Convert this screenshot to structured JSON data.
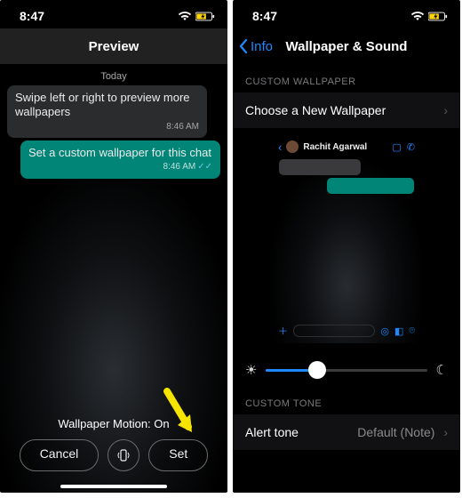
{
  "left": {
    "time": "8:47",
    "title": "Preview",
    "dateLabel": "Today",
    "msg_in": "Swipe left or right to preview more wallpapers",
    "msg_in_ts": "8:46 AM",
    "msg_out": "Set a custom wallpaper for this chat",
    "msg_out_ts": "8:46 AM",
    "motion": "Wallpaper Motion: On",
    "cancel": "Cancel",
    "set": "Set"
  },
  "right": {
    "time": "8:47",
    "back": "Info",
    "title": "Wallpaper & Sound",
    "sec_wallpaper": "CUSTOM WALLPAPER",
    "choose": "Choose a New Wallpaper",
    "contact": "Rachit Agarwal",
    "sec_tone": "CUSTOM TONE",
    "alert": "Alert tone",
    "alert_value": "Default (Note)"
  }
}
